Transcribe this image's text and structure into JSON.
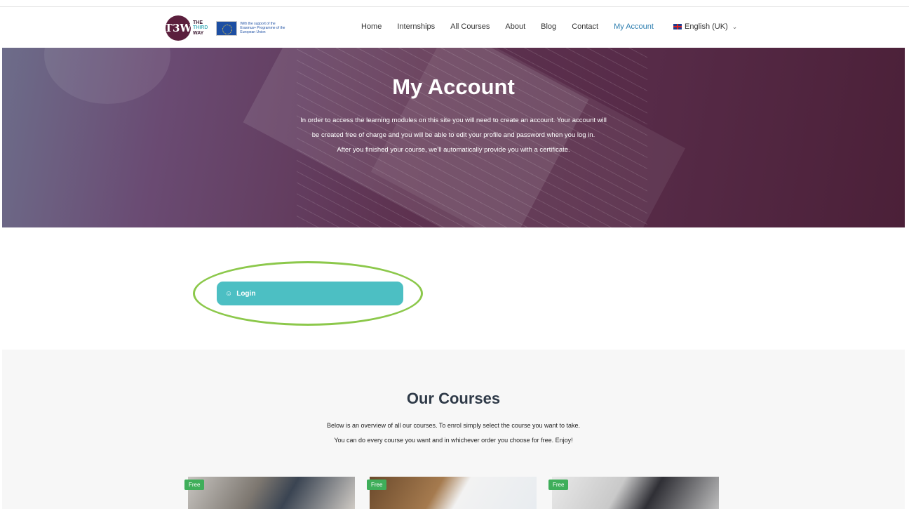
{
  "logo": {
    "initials": "T3W",
    "name_line1": "THE",
    "name_line2": "THIRD",
    "name_line3": "WAY",
    "eu_text": "With the support of the Erasmus+ Programme of the European Union"
  },
  "nav": {
    "items": [
      {
        "label": "Home"
      },
      {
        "label": "Internships"
      },
      {
        "label": "All Courses"
      },
      {
        "label": "About"
      },
      {
        "label": "Blog"
      },
      {
        "label": "Contact"
      },
      {
        "label": "My Account",
        "active": true
      }
    ],
    "language": "English (UK)",
    "language_icon": "uk-flag-icon",
    "active_color": "#2f7fb0"
  },
  "hero": {
    "title": "My Account",
    "text_line1": "In order to access the learning modules on this site you will need to create an account. Your account will",
    "text_line2": "be created free of charge and you will be able to edit your profile and password when you log in.",
    "text_line3": "After you finished your course, we'll automatically provide you with a certificate.",
    "overlay_color": "#572b48"
  },
  "login": {
    "label": "Login",
    "icon": "user-icon",
    "button_color": "#4cbfc3",
    "highlight_color": "#8cc84b"
  },
  "courses": {
    "title": "Our Courses",
    "text_line1": "Below is an overview of all our courses. To enrol simply select the course you want to take.",
    "text_line2": "You can do every course you want and in whichever order you choose for free. Enjoy!",
    "cards": [
      {
        "badge": "Free"
      },
      {
        "badge": "Free"
      },
      {
        "badge": "Free"
      }
    ],
    "badge_color": "#3fae5a"
  }
}
